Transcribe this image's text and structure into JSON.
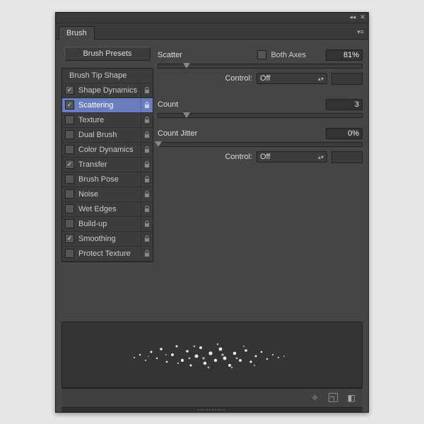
{
  "panel": {
    "tab": "Brush"
  },
  "presets_button": "Brush Presets",
  "options": [
    {
      "label": "Brush Tip Shape",
      "header": true
    },
    {
      "label": "Shape Dynamics",
      "checked": true,
      "lock": true
    },
    {
      "label": "Scattering",
      "checked": true,
      "lock": true,
      "selected": true
    },
    {
      "label": "Texture",
      "checked": false,
      "lock": true
    },
    {
      "label": "Dual Brush",
      "checked": false,
      "lock": true
    },
    {
      "label": "Color Dynamics",
      "checked": false,
      "lock": true
    },
    {
      "label": "Transfer",
      "checked": true,
      "lock": true
    },
    {
      "label": "Brush Pose",
      "checked": false,
      "lock": true
    },
    {
      "label": "Noise",
      "checked": false,
      "lock": true
    },
    {
      "label": "Wet Edges",
      "checked": false,
      "lock": true
    },
    {
      "label": "Build-up",
      "checked": false,
      "lock": true
    },
    {
      "label": "Smoothing",
      "checked": true,
      "lock": true
    },
    {
      "label": "Protect Texture",
      "checked": false,
      "lock": true
    }
  ],
  "scatter": {
    "label": "Scatter",
    "both_axes_label": "Both Axes",
    "both_axes_checked": false,
    "value": "81%",
    "slider_pct": 14,
    "control_label": "Control:",
    "control_value": "Off"
  },
  "count": {
    "label": "Count",
    "value": "3",
    "slider_pct": 14
  },
  "count_jitter": {
    "label": "Count Jitter",
    "value": "0%",
    "slider_pct": 0,
    "control_label": "Control:",
    "control_value": "Off"
  }
}
